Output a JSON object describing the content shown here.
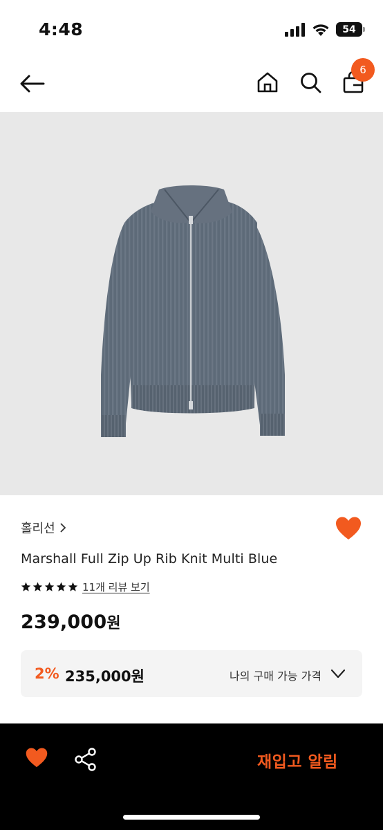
{
  "status_bar": {
    "time": "4:48",
    "battery": "54"
  },
  "nav": {
    "back_icon": "arrow-left-icon",
    "home_icon": "home-icon",
    "search_icon": "search-icon",
    "bag_icon": "shopping-bag-icon",
    "bag_count": "6"
  },
  "product": {
    "image_icon": "zip-knit-cardigan-photo",
    "brand": "홀리선",
    "name": "Marshall Full Zip Up Rib Knit Multi Blue",
    "rating_stars": 5,
    "review_link": "11개 리뷰 보기",
    "price": "239,000",
    "price_unit": "원",
    "my_price": {
      "discount": "2%",
      "price": "235,000원",
      "label": "나의 구매 가능 가격"
    }
  },
  "bottom_bar": {
    "restock_label": "재입고 알림"
  },
  "colors": {
    "accent": "#f25a1f",
    "image_bg": "#e8e8e8",
    "box_bg": "#f4f4f4"
  }
}
